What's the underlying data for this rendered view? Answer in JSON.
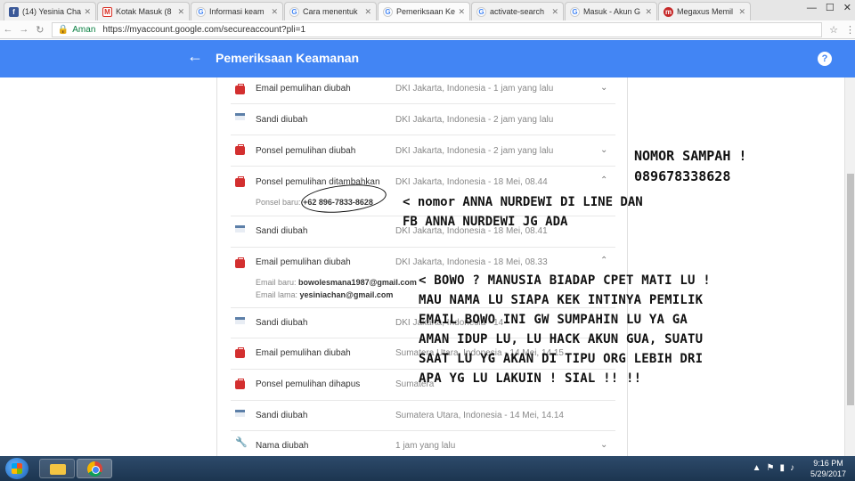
{
  "browser": {
    "tabs": [
      {
        "label": "(14) Yesinia Cha",
        "icon": "facebook-icon",
        "active": false
      },
      {
        "label": "Kotak Masuk (8",
        "icon": "gmail-icon",
        "active": false
      },
      {
        "label": "Informasi keam",
        "icon": "google-icon",
        "active": false
      },
      {
        "label": "Cara menentuk",
        "icon": "google-icon",
        "active": false
      },
      {
        "label": "Pemeriksaan Ke",
        "icon": "google-icon",
        "active": true
      },
      {
        "label": "activate-search",
        "icon": "google-icon",
        "active": false
      },
      {
        "label": "Masuk - Akun G",
        "icon": "google-icon",
        "active": false
      },
      {
        "label": "Megaxus Memil",
        "icon": "megaxus-icon",
        "active": false
      }
    ],
    "secure_label": "Aman",
    "url": "https://myaccount.google.com/secureaccount?pli=1"
  },
  "appbar": {
    "title": "Pemeriksaan Keamanan",
    "help": "?"
  },
  "events": [
    {
      "title": "Email pemulihan diubah",
      "meta": "DKI Jakarta, Indonesia - 1 jam yang lalu",
      "icon": "briefcase-icon",
      "expanded": false
    },
    {
      "title": "Sandi diubah",
      "meta": "DKI Jakarta, Indonesia - 2 jam yang lalu",
      "icon": "key-icon",
      "expanded": false
    },
    {
      "title": "Ponsel pemulihan diubah",
      "meta": "DKI Jakarta, Indonesia - 2 jam yang lalu",
      "icon": "briefcase-icon",
      "expanded": false
    },
    {
      "title": "Ponsel pemulihan ditambahkan",
      "meta": "DKI Jakarta, Indonesia - 18 Mei, 08.44",
      "icon": "briefcase-icon",
      "expanded": true
    },
    {
      "title": "Sandi diubah",
      "meta": "DKI Jakarta, Indonesia - 18 Mei, 08.41",
      "icon": "key-icon",
      "expanded": false
    },
    {
      "title": "Email pemulihan diubah",
      "meta": "DKI Jakarta, Indonesia - 18 Mei, 08.33",
      "icon": "briefcase-icon",
      "expanded": true
    },
    {
      "title": "Sandi diubah",
      "meta": "DKI Jakarta, Indonesia - 14",
      "icon": "key-icon",
      "expanded": false
    },
    {
      "title": "Email pemulihan diubah",
      "meta": "Sumatera Utara, Indonesia - 14 Mei, 14.15",
      "icon": "briefcase-icon",
      "expanded": false
    },
    {
      "title": "Ponsel pemulihan dihapus",
      "meta": "Sumatera",
      "icon": "briefcase-icon",
      "expanded": false
    },
    {
      "title": "Sandi diubah",
      "meta": "Sumatera Utara, Indonesia - 14 Mei, 14.14",
      "icon": "key-icon",
      "expanded": false
    },
    {
      "title": "Nama diubah",
      "meta": "1 jam yang lalu",
      "icon": "wrench-icon",
      "expanded": false
    }
  ],
  "details": {
    "phone_label": "Ponsel baru:",
    "phone_value": "+62 896-7833-8628",
    "new_email_label": "Email baru:",
    "new_email_value": "bowolesmana1987@gmail.com",
    "old_email_label": "Email lama:",
    "old_email_value": "yesiniachan@gmail.com"
  },
  "annotations": {
    "a1": [
      "NOMOR SAMPAH !",
      "089678338628"
    ],
    "a2": [
      "< nomor ANNA NURDEWI DI LINE DAN",
      "FB ANNA NURDEWI JG ADA"
    ],
    "a3": [
      "< BOWO ? MANUSIA BIADAP CPET MATI LU !",
      "MAU NAMA LU SIAPA KEK INTINYA PEMILIK",
      "EMAIL BOWO INI GW SUMPAHIN LU YA GA",
      "AMAN IDUP LU, LU HACK AKUN GUA, SUATU",
      "SAAT LU YG AKAN DI TIPU ORG LEBIH DRI",
      "APA YG LU LAKUIN ! SIAL !! !!"
    ]
  },
  "taskbar": {
    "time": "9:16 PM",
    "date": "5/29/2017"
  }
}
